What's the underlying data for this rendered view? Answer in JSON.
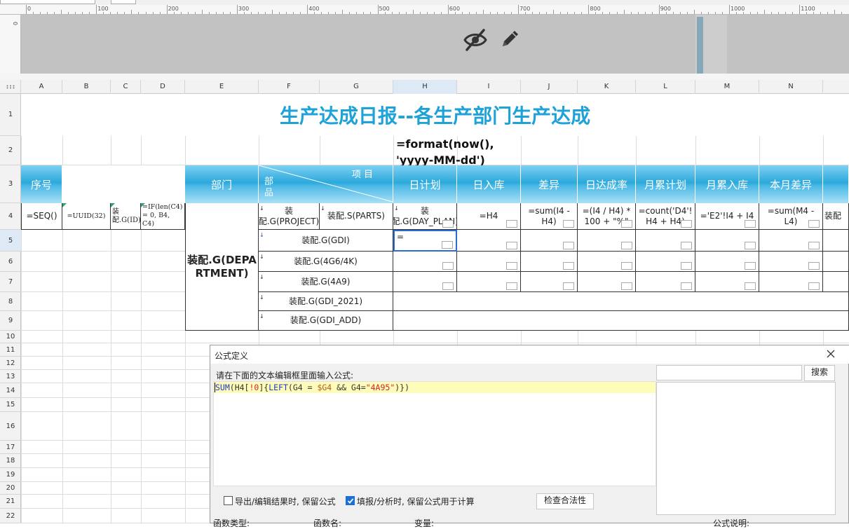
{
  "ruler": {
    "numbers": [
      "0",
      "100",
      "200",
      "300",
      "400",
      "500",
      "600",
      "700",
      "800",
      "900",
      "1000",
      "1100"
    ],
    "vertical_label": "0"
  },
  "columns": [
    "A",
    "B",
    "C",
    "D",
    "E",
    "F",
    "G",
    "H",
    "I",
    "J",
    "K",
    "L",
    "M",
    "N"
  ],
  "selected_column": "H",
  "rows": [
    "1",
    "2",
    "3",
    "4",
    "5",
    "6",
    "7",
    "8",
    "9",
    "10",
    "11",
    "12",
    "13",
    "14",
    "15",
    "16",
    "17",
    "18",
    "19",
    "20",
    "21",
    "22"
  ],
  "selected_row": "5",
  "sheet": {
    "title": "生产达成日报--各生产部门生产达成",
    "date_formula": "=format(now(), 'yyyy-MM-dd')",
    "headers": {
      "seq": "序号",
      "dept": "部门",
      "item_label": "项 目",
      "part_label": "部\n品",
      "day_plan": "日计划",
      "day_in": "日入库",
      "diff": "差异",
      "day_rate": "日达成率",
      "month_plan": "月累计划",
      "month_in": "月累入库",
      "month_diff": "本月差异"
    },
    "row4": {
      "a": "=SEQ()",
      "b": "=UUID(32)",
      "c": "装配.G(ID)",
      "d": "=IF(len(C4) = 0, B4, C4)",
      "f": "装配.G(PROJECT)",
      "g": "装配.S(PARTS)",
      "h": "装配.G(DAY_PLAN)",
      "i": "=H4",
      "j": "=sum(I4 - H4)",
      "k": "=(I4 / H4) * 100 + \"%\"",
      "l": "=count('D4'! H4 + H4)",
      "m": "='E2'!I4 + I4",
      "n": "=sum(M4 - L4)",
      "o": "装配"
    },
    "dept_cell": "装配.G(DEPARTMENT)",
    "active_cell_value": "=",
    "groups": [
      "装配.G(GDI)",
      "装配.G(4G6/4K)",
      "装配.G(4A9)",
      "装配.G(GDI_2021)",
      "装配.G(GDI_ADD)"
    ]
  },
  "dialog": {
    "title": "公式定义",
    "prompt": "请在下面的文本编辑框里面输入公式:",
    "formula": {
      "fn": "SUM",
      "open": "(H4[",
      "idx": "!0",
      "mid": "]{",
      "fn2": "LEFT",
      "cond_a": "(G4 = ",
      "var": "$G4",
      "cond_b": " && G4=",
      "str": "\"4A95\"",
      "close": ")})"
    },
    "search_button": "搜索",
    "keep_formula_on_export": "导出/编辑结果时, 保留公式",
    "keep_formula_on_fill": "填报/分析时, 保留公式用于计算",
    "keep_formula_on_fill_checked": true,
    "validate_button": "检查合法性",
    "bottom_labels": {
      "function_type": "函数类型:",
      "function_name": "函数名:",
      "variable": "变量:",
      "description": "公式说明:"
    }
  }
}
